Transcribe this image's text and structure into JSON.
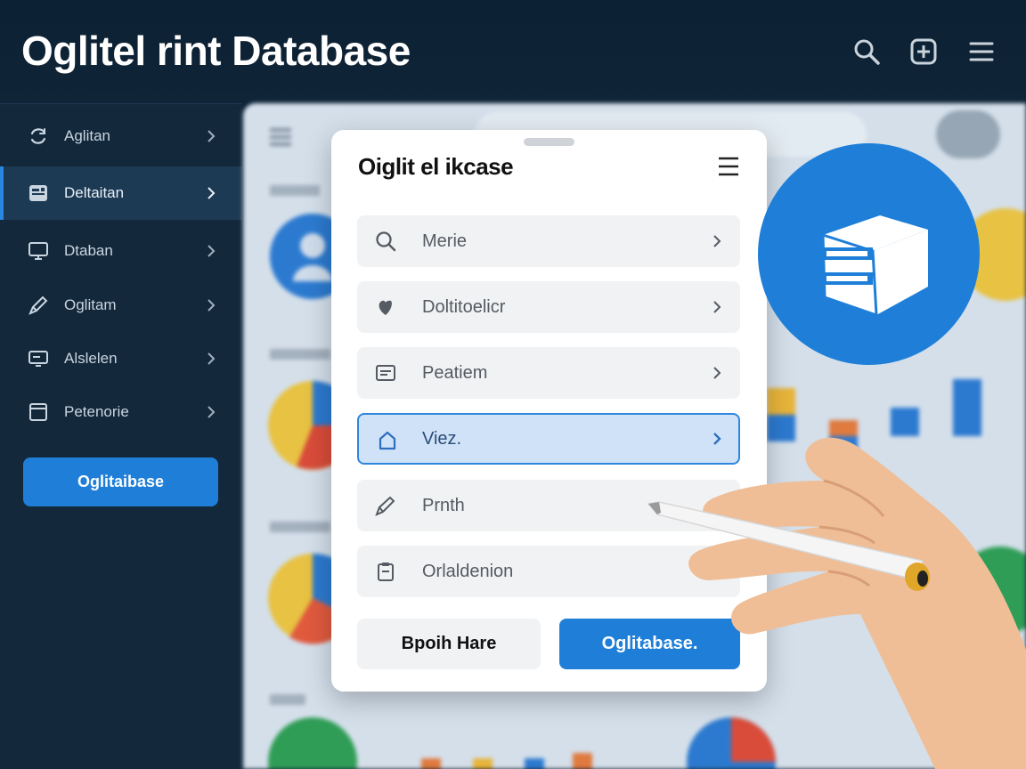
{
  "header": {
    "title": "Oglitel rint Database",
    "icons": [
      "search-icon",
      "add-icon",
      "menu-icon"
    ]
  },
  "sidebar": {
    "items": [
      {
        "label": "Aglitan",
        "icon": "sync-icon",
        "active": false
      },
      {
        "label": "Deltaitan",
        "icon": "dashboard-icon",
        "active": true
      },
      {
        "label": "Dtaban",
        "icon": "monitor-icon",
        "active": false
      },
      {
        "label": "Oglitam",
        "icon": "pen-icon",
        "active": false
      },
      {
        "label": "Alslelen",
        "icon": "screen-icon",
        "active": false
      },
      {
        "label": "Petenorie",
        "icon": "window-icon",
        "active": false
      }
    ],
    "button_label": "Oglitaibase"
  },
  "dialog": {
    "title": "Oiglit el ikcase",
    "rows": [
      {
        "label": "Merie",
        "icon": "search-icon",
        "selected": false,
        "chevron": true
      },
      {
        "label": "Doltitoelicr",
        "icon": "heart-icon",
        "selected": false,
        "chevron": true
      },
      {
        "label": "Peatiem",
        "icon": "document-icon",
        "selected": false,
        "chevron": true
      },
      {
        "label": "Viez.",
        "icon": "home-icon",
        "selected": true,
        "chevron": true
      },
      {
        "label": "Prnth",
        "icon": "pen-icon",
        "selected": false,
        "chevron": false
      },
      {
        "label": "Orlaldenion",
        "icon": "clipboard-icon",
        "selected": false,
        "chevron": false
      }
    ],
    "secondary_button": "Bpoih Hare",
    "primary_button": "Oglitabase."
  },
  "colors": {
    "accent": "#1f7fd8",
    "header_bg": "#0c2133",
    "sidebar_bg": "#13283b",
    "dialog_bg": "#ffffff",
    "selected_row_bg": "#cfe2f8"
  },
  "logo": {
    "icon": "database-box-icon"
  }
}
